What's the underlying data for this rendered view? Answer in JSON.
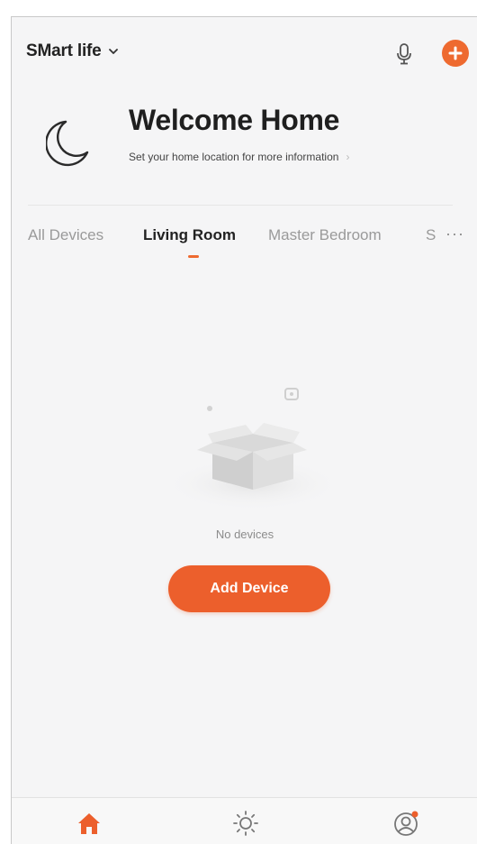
{
  "header": {
    "home_name": "SMart life",
    "mic_icon": "microphone-icon",
    "add_icon": "plus-circle-icon",
    "accent_color": "#ee6a30"
  },
  "welcome": {
    "title": "Welcome Home",
    "subtitle": "Set your home location for more information",
    "subtitle_chevron": "›",
    "icon": "moon-icon"
  },
  "tabs": {
    "items": [
      {
        "label": "All Devices",
        "active": false
      },
      {
        "label": "Living Room",
        "active": true
      },
      {
        "label": "Master Bedroom",
        "active": false
      },
      {
        "label": "S",
        "active": false
      }
    ],
    "more_label": "···"
  },
  "empty_state": {
    "illustration": "empty-box-icon",
    "message": "No devices",
    "button_label": "Add Device"
  },
  "bottom_nav": {
    "items": [
      {
        "name": "home",
        "icon": "home-icon",
        "active": true
      },
      {
        "name": "smart",
        "icon": "sun-icon",
        "active": false
      },
      {
        "name": "me",
        "icon": "profile-icon",
        "active": false
      }
    ]
  }
}
